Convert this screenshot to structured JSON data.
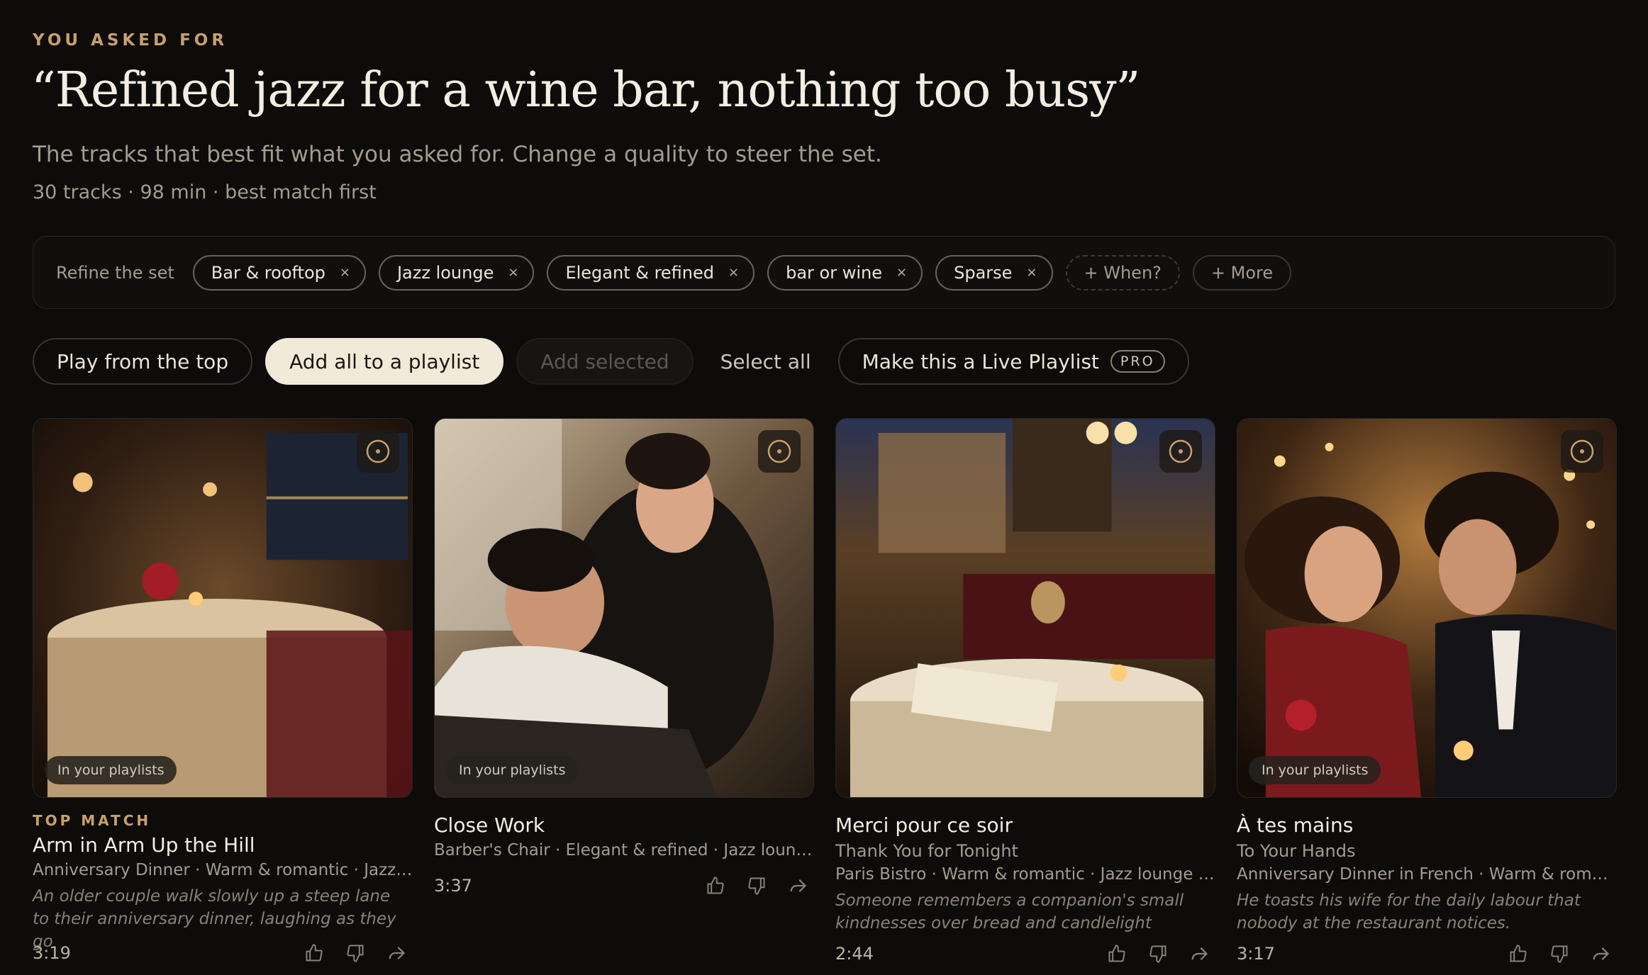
{
  "header": {
    "eyebrow": "YOU ASKED FOR",
    "headline": "“Refined jazz for a wine bar, nothing too busy”",
    "subline": "The tracks that best fit what you asked for. Change a quality to steer the set.",
    "meta": "30 tracks · 98 min · best match first"
  },
  "refine": {
    "label": "Refine the set",
    "chips": [
      {
        "label": "Bar & rooftop"
      },
      {
        "label": "Jazz lounge"
      },
      {
        "label": "Elegant & refined"
      },
      {
        "label": "bar or wine"
      },
      {
        "label": "Sparse"
      }
    ],
    "remove_glyph": "×",
    "when_label": "+ When?",
    "more_label": "+ More"
  },
  "actions": {
    "play": "Play from the top",
    "add_all": "Add all to a playlist",
    "add_selected": "Add selected",
    "select_all": "Select all",
    "live": "Make this a Live Playlist",
    "pro": "PRO"
  },
  "colors": {
    "accent": "#c9a06a",
    "background": "#0e0c0a",
    "primary_button": "#f2ead9"
  },
  "tracks": [
    {
      "badge": "In your playlists",
      "top_match": "TOP MATCH",
      "title": "Arm in Arm Up the Hill",
      "subtitle": "",
      "tags": "Anniversary Dinner · Warm & romantic · Jazz lo...",
      "desc": "An older couple walk slowly up a steep lane to their anniversary dinner, laughing as they go",
      "duration": "3:19",
      "icons": [
        "thumbs-up-icon",
        "thumbs-down-icon",
        "share-icon"
      ]
    },
    {
      "badge": "In your playlists",
      "top_match": "",
      "title": "Close Work",
      "subtitle": "",
      "tags": "Barber's Chair · Elegant & refined · Jazz lounge ...",
      "desc": "",
      "duration": "3:37",
      "icons": [
        "thumbs-up-icon",
        "thumbs-down-icon",
        "share-icon"
      ]
    },
    {
      "badge": "",
      "top_match": "",
      "title": "Merci pour ce soir",
      "subtitle": "Thank You for Tonight",
      "tags": "Paris Bistro · Warm & romantic · Jazz lounge · F...",
      "desc": "Someone remembers a companion's small kindnesses over bread and candlelight",
      "duration": "2:44",
      "icons": [
        "thumbs-up-icon",
        "thumbs-down-icon",
        "share-icon"
      ]
    },
    {
      "badge": "In your playlists",
      "top_match": "",
      "title": "À tes mains",
      "subtitle": "To Your Hands",
      "tags": "Anniversary Dinner in French · Warm & romanti...",
      "desc": "He toasts his wife for the daily labour that nobody at the restaurant notices.",
      "duration": "3:17",
      "icons": [
        "thumbs-up-icon",
        "thumbs-down-icon",
        "share-icon"
      ]
    }
  ]
}
